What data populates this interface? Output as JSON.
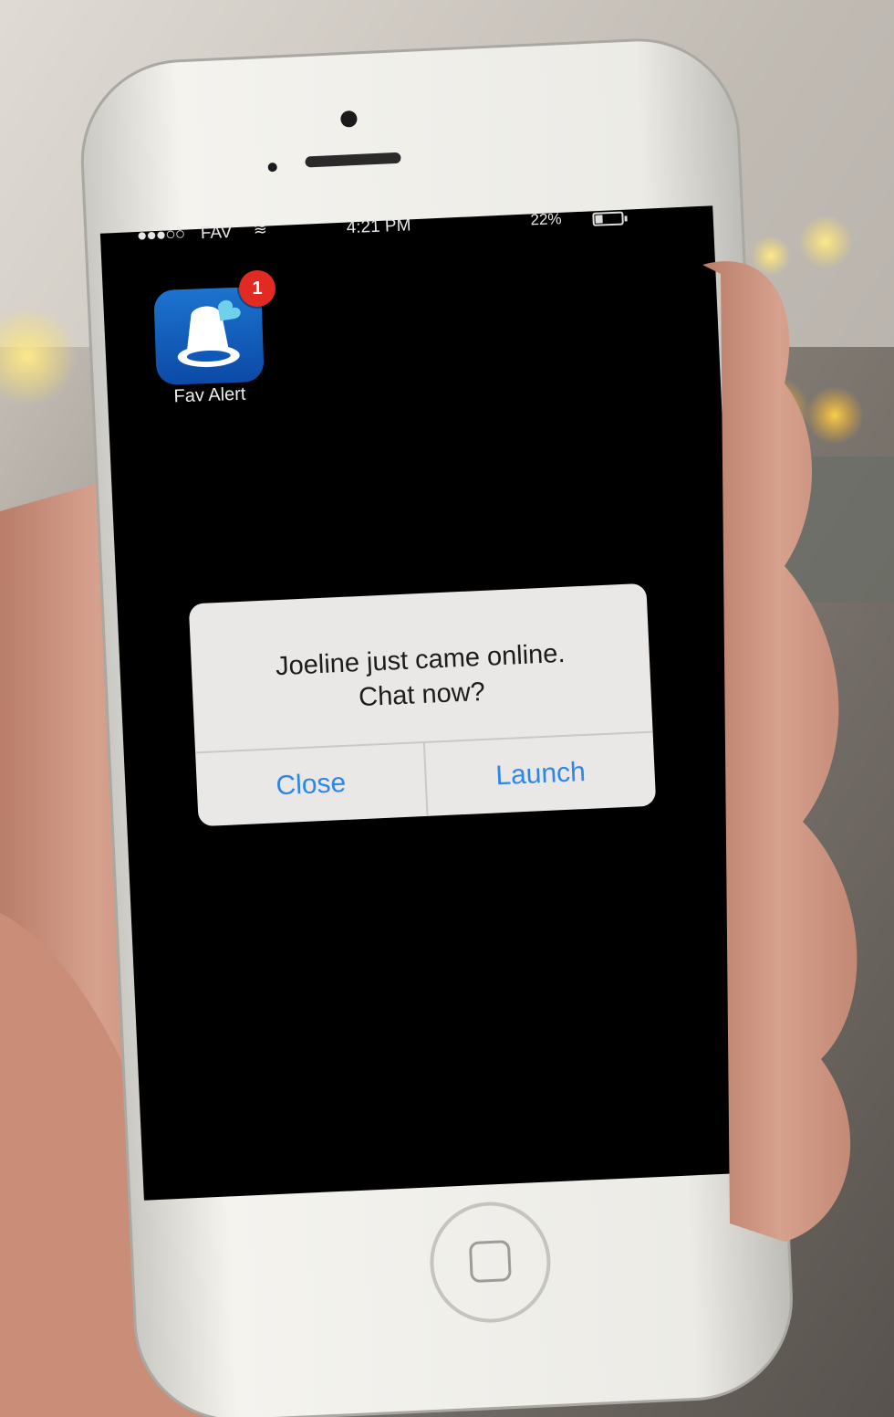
{
  "status_bar": {
    "signal": "●●●○○",
    "carrier": "FAV",
    "time": "4:21 PM",
    "battery": "22%"
  },
  "home_screen": {
    "app": {
      "label": "Fav Alert",
      "badge_count": "1"
    }
  },
  "alert": {
    "message_line1": "Joeline just came online.",
    "message_line2": "Chat now?",
    "close_label": "Close",
    "launch_label": "Launch"
  },
  "colors": {
    "button_text": "#2e86e6",
    "badge": "#e02a22",
    "app_icon": "#1565c4",
    "screen": "#000000",
    "phone_body": "#ecebe6"
  }
}
